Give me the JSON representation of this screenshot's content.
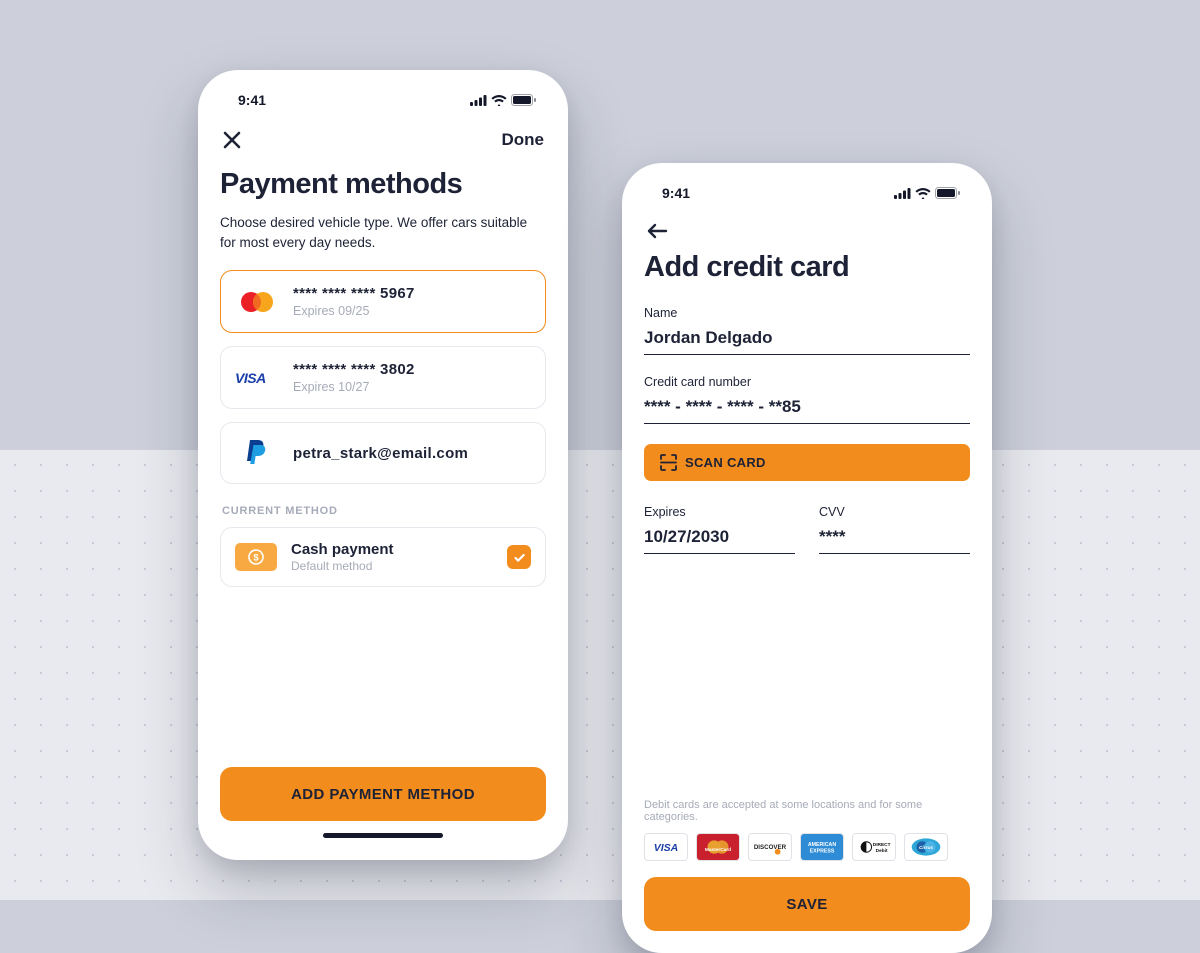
{
  "status": {
    "time": "9:41"
  },
  "screenA": {
    "done_label": "Done",
    "title": "Payment methods",
    "subtitle": "Choose desired vehicle type. We offer cars suitable for most every day needs.",
    "methods": [
      {
        "brand": "mastercard",
        "number": "**** **** **** 5967",
        "expiry": "Expires 09/25",
        "selected": true
      },
      {
        "brand": "visa",
        "number": "**** **** **** 3802",
        "expiry": "Expires 10/27",
        "selected": false
      },
      {
        "brand": "paypal",
        "number": "petra_stark@email.com",
        "expiry": "",
        "selected": false
      }
    ],
    "current_section_label": "CURRENT METHOD",
    "cash": {
      "title": "Cash payment",
      "sub": "Default method"
    },
    "add_button": "ADD PAYMENT METHOD"
  },
  "screenB": {
    "title": "Add credit card",
    "fields": {
      "name_label": "Name",
      "name_value": "Jordan Delgado",
      "cc_label": "Credit card number",
      "cc_value": "**** - **** - **** - **85",
      "expires_label": "Expires",
      "expires_value": "10/27/2030",
      "cvv_label": "CVV",
      "cvv_value": "****"
    },
    "scan_label": "SCAN CARD",
    "footnote": "Debit cards are accepted at some locations and for some categories.",
    "save_label": "SAVE",
    "accepted_brands": [
      "VISA",
      "MasterCard",
      "DISCOVER",
      "AMERICAN EXPRESS",
      "Direct Debit",
      "Cirrus"
    ]
  },
  "colors": {
    "accent": "#f28c1c",
    "text": "#1d2236",
    "muted": "#a6abb8"
  }
}
